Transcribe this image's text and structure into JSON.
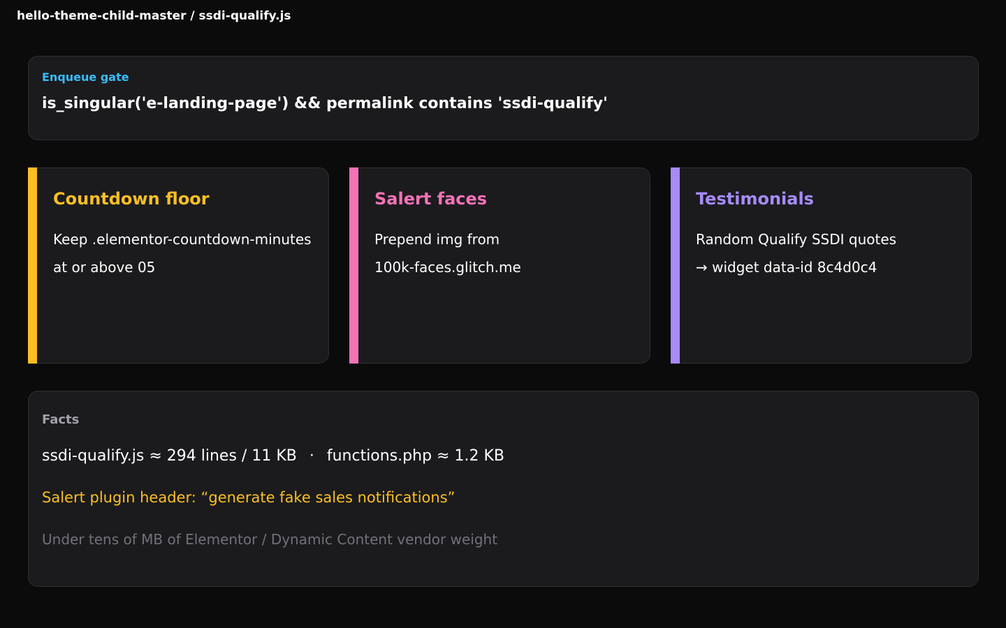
{
  "breadcrumb": "hello-theme-child-master / ssdi-qualify.js",
  "gate": {
    "label": "Enqueue gate",
    "expression": "is_singular('e-landing-page') && permalink contains 'ssdi-qualify'"
  },
  "cards": [
    {
      "title": "Countdown floor",
      "color": "#fbbf24",
      "lines": [
        "Keep .elementor-countdown-minutes",
        "at or above 05"
      ]
    },
    {
      "title": "Salert faces",
      "color": "#f472b6",
      "lines": [
        "Prepend img from",
        "100k-faces.glitch.me"
      ]
    },
    {
      "title": "Testimonials",
      "color": "#a78bfa",
      "lines": [
        "Random Qualify SSDI quotes",
        "→ widget data-id 8c4d0c4"
      ]
    }
  ],
  "facts": {
    "label": "Facts",
    "sizes_left": "ssdi-qualify.js ≈ 294 lines / 11 KB",
    "separator": "·",
    "sizes_right": "functions.php ≈ 1.2 KB",
    "salert_header": "Salert plugin header: “generate fake sales notifications”",
    "vendor_note": "Under tens of MB of Elementor / Dynamic Content vendor weight"
  }
}
